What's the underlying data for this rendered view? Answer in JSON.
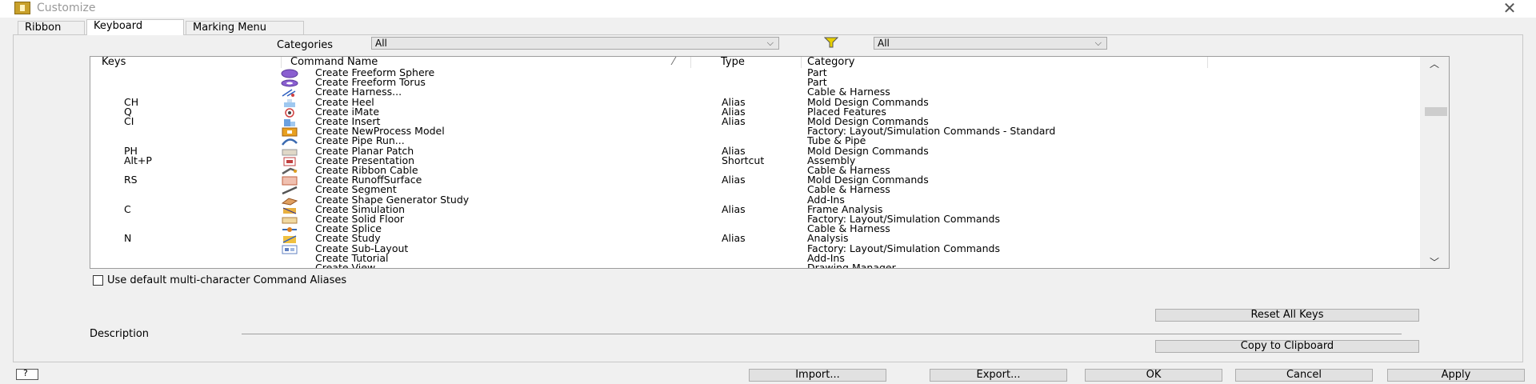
{
  "window": {
    "title": "Customize"
  },
  "tabs": [
    {
      "label": "Ribbon"
    },
    {
      "label": "Keyboard"
    },
    {
      "label": "Marking Menu"
    }
  ],
  "filters": {
    "categories_label": "Categories",
    "categories_value": "All",
    "type_filter_value": "All"
  },
  "table": {
    "columns": {
      "keys": "Keys",
      "command": "Command Name",
      "type": "Type",
      "category": "Category"
    },
    "rows": [
      {
        "keys": "",
        "command": "Create Freeform Sphere",
        "type": "",
        "category": "Part",
        "icon": "sphere-icon"
      },
      {
        "keys": "",
        "command": "Create Freeform Torus",
        "type": "",
        "category": "Part",
        "icon": "torus-icon"
      },
      {
        "keys": "",
        "command": "Create Harness...",
        "type": "",
        "category": "Cable & Harness",
        "icon": "harness-icon"
      },
      {
        "keys": "CH",
        "command": "Create Heel",
        "type": "Alias",
        "category": "Mold Design Commands",
        "icon": "heel-icon"
      },
      {
        "keys": "Q",
        "command": "Create iMate",
        "type": "Alias",
        "category": "Placed Features",
        "icon": "imate-icon"
      },
      {
        "keys": "CI",
        "command": "Create Insert",
        "type": "Alias",
        "category": "Mold Design Commands",
        "icon": "insert-icon"
      },
      {
        "keys": "",
        "command": "Create NewProcess Model",
        "type": "",
        "category": "Factory: Layout/Simulation Commands - Standard",
        "icon": "process-model-icon"
      },
      {
        "keys": "",
        "command": "Create Pipe Run...",
        "type": "",
        "category": "Tube & Pipe",
        "icon": "pipe-run-icon"
      },
      {
        "keys": "PH",
        "command": "Create Planar Patch",
        "type": "Alias",
        "category": "Mold Design Commands",
        "icon": "planar-patch-icon"
      },
      {
        "keys": "Alt+P",
        "command": "Create Presentation",
        "type": "Shortcut",
        "category": "Assembly",
        "icon": "presentation-icon"
      },
      {
        "keys": "",
        "command": "Create Ribbon Cable",
        "type": "",
        "category": "Cable & Harness",
        "icon": "ribbon-cable-icon"
      },
      {
        "keys": "RS",
        "command": "Create RunoffSurface",
        "type": "Alias",
        "category": "Mold Design Commands",
        "icon": "runoff-surface-icon"
      },
      {
        "keys": "",
        "command": "Create Segment",
        "type": "",
        "category": "Cable & Harness",
        "icon": "segment-icon"
      },
      {
        "keys": "",
        "command": "Create Shape Generator Study",
        "type": "",
        "category": "Add-Ins",
        "icon": "shape-generator-icon"
      },
      {
        "keys": "C",
        "command": "Create Simulation",
        "type": "Alias",
        "category": "Frame Analysis",
        "icon": "simulation-icon"
      },
      {
        "keys": "",
        "command": "Create Solid Floor",
        "type": "",
        "category": "Factory: Layout/Simulation Commands",
        "icon": "solid-floor-icon"
      },
      {
        "keys": "",
        "command": "Create Splice",
        "type": "",
        "category": "Cable & Harness",
        "icon": "splice-icon"
      },
      {
        "keys": "N",
        "command": "Create Study",
        "type": "Alias",
        "category": "Analysis",
        "icon": "study-icon"
      },
      {
        "keys": "",
        "command": "Create Sub-Layout",
        "type": "",
        "category": "Factory: Layout/Simulation Commands",
        "icon": "sub-layout-icon"
      },
      {
        "keys": "",
        "command": "Create Tutorial",
        "type": "",
        "category": "Add-Ins",
        "icon": ""
      },
      {
        "keys": "",
        "command": "Create View",
        "type": "",
        "category": "Drawing Manager",
        "icon": ""
      }
    ]
  },
  "checkbox": {
    "label": "Use default multi-character Command Aliases"
  },
  "description_label": "Description",
  "buttons": {
    "reset_all_keys": "Reset All Keys",
    "copy_to_clipboard": "Copy to Clipboard",
    "import": "Import...",
    "export": "Export...",
    "ok": "OK",
    "cancel": "Cancel",
    "apply": "Apply"
  },
  "colors": {
    "filter_icon": "#e8d000",
    "sphere": "#8a5fd0"
  }
}
